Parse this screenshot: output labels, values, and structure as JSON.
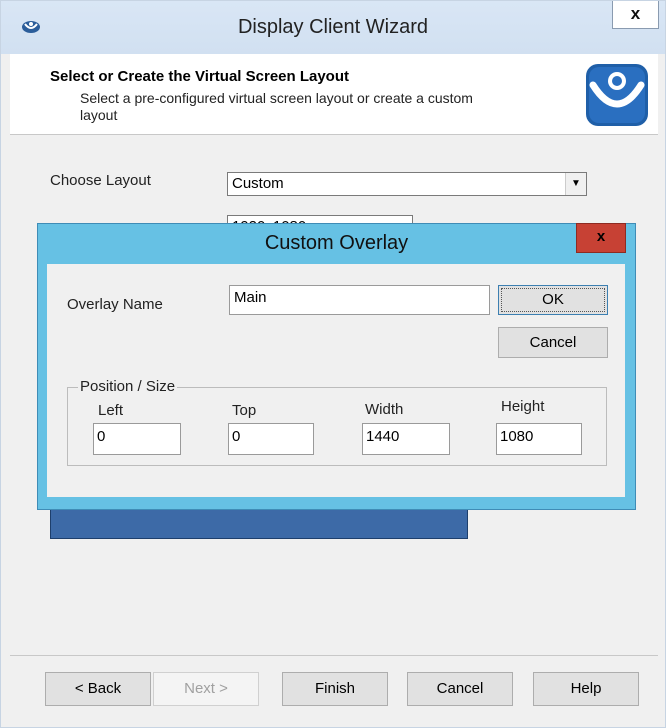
{
  "wizard": {
    "title": "Display Client Wizard",
    "close_label": "x",
    "header": {
      "title": "Select or Create the Virtual Screen Layout",
      "subtitle_line1": "Select a pre-configured virtual screen layout or create a custom",
      "subtitle_line2": "layout"
    },
    "body": {
      "choose_layout_label": "Choose Layout",
      "layout_value": "Custom",
      "resolution_value": "1920x1080"
    },
    "footer": {
      "back": "< Back",
      "next": "Next >",
      "finish": "Finish",
      "cancel": "Cancel",
      "help": "Help"
    }
  },
  "overlay_dialog": {
    "title": "Custom Overlay",
    "close_label": "x",
    "overlay_name_label": "Overlay Name",
    "overlay_name_value": "Main",
    "ok": "OK",
    "cancel": "Cancel",
    "group_label": "Position / Size",
    "fields": {
      "left_label": "Left",
      "left_value": "0",
      "top_label": "Top",
      "top_value": "0",
      "width_label": "Width",
      "width_value": "1440",
      "height_label": "Height",
      "height_value": "1080"
    }
  },
  "colors": {
    "overlay_frame": "#66c1e4",
    "close_red": "#c74134",
    "preview_blue": "#3d6aa7"
  }
}
